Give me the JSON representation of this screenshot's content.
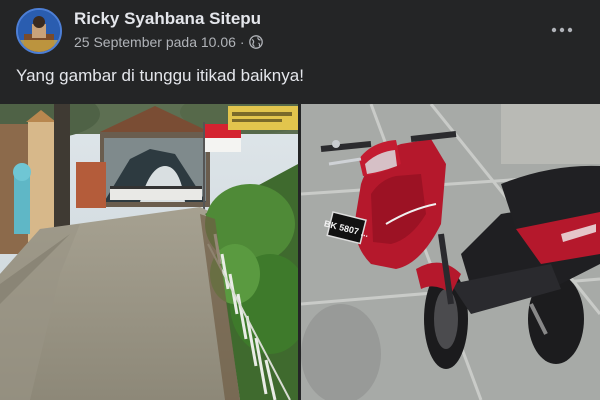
{
  "post": {
    "author": "Ricky Syahbana Sitepu",
    "date": "25 September pada 10.06",
    "separator": "·",
    "privacy_icon": "globe-icon",
    "more_icon": "more-options-icon",
    "text": "Yang gambar di tunggu itikad baiknya!"
  },
  "photos": {
    "left": {
      "plate_text": ""
    },
    "right": {
      "plate_text": "BK 5807 ..."
    }
  },
  "colors": {
    "background": "#242526",
    "text_primary": "#e4e6eb",
    "text_secondary": "#b0b3b8",
    "motorbike_red": "#b5182c"
  }
}
